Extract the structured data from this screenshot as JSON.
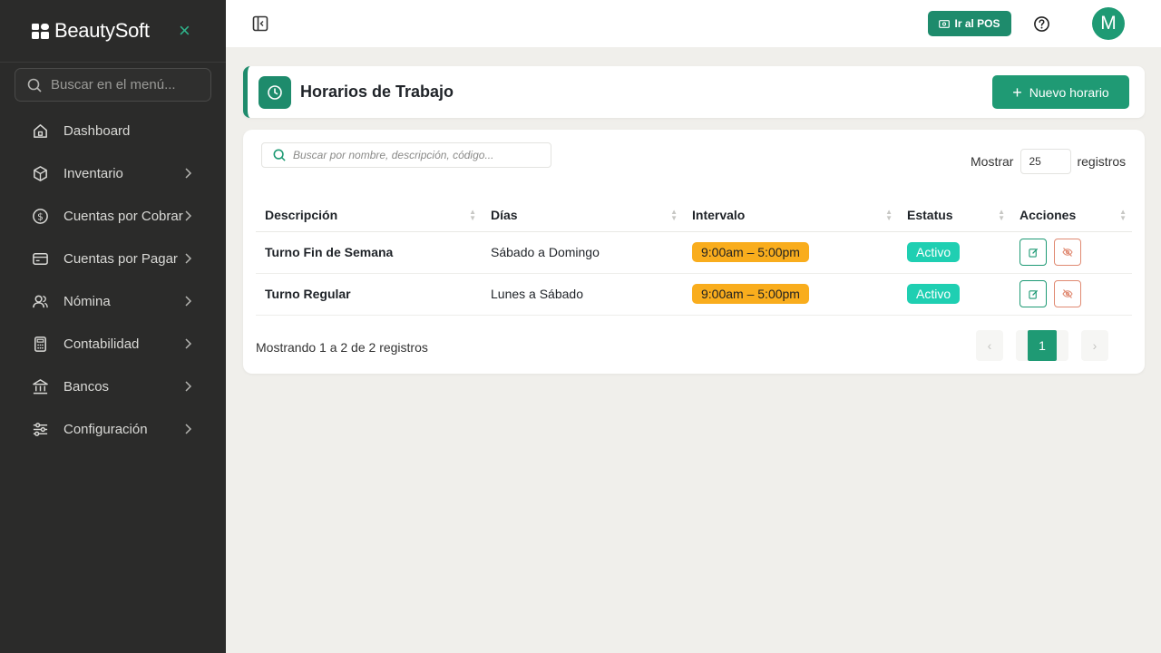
{
  "brand": {
    "name": "BeautySoft"
  },
  "sidebar": {
    "search_placeholder": "Buscar en el menú...",
    "items": [
      {
        "label": "Dashboard",
        "icon": "home-icon"
      },
      {
        "label": "Inventario",
        "icon": "box-icon"
      },
      {
        "label": "Cuentas por Cobrar",
        "icon": "dollar-icon"
      },
      {
        "label": "Cuentas por Pagar",
        "icon": "card-icon"
      },
      {
        "label": "Nómina",
        "icon": "users-icon"
      },
      {
        "label": "Contabilidad",
        "icon": "calculator-icon"
      },
      {
        "label": "Bancos",
        "icon": "bank-icon"
      },
      {
        "label": "Configuración",
        "icon": "sliders-icon"
      }
    ]
  },
  "topbar": {
    "pos_label": "Ir al POS",
    "avatar_initial": "M"
  },
  "page": {
    "title": "Horarios de Trabajo",
    "new_button": "Nuevo horario"
  },
  "table": {
    "search_placeholder": "Buscar por nombre, descripción, código...",
    "show_label": "Mostrar",
    "show_value": "25",
    "records_label": "registros",
    "columns": [
      "Descripción",
      "Días",
      "Intervalo",
      "Estatus",
      "Acciones"
    ],
    "rows": [
      {
        "description": "Turno Fin de Semana",
        "days": "Sábado a Domingo",
        "interval": "9:00am – 5:00pm",
        "status": "Activo"
      },
      {
        "description": "Turno Regular",
        "days": "Lunes a Sábado",
        "interval": "9:00am – 5:00pm",
        "status": "Activo"
      }
    ],
    "footer_info": "Mostrando 1 a 2 de 2 registros",
    "pager": {
      "prev": "‹",
      "current": "1",
      "next": "›"
    }
  },
  "colors": {
    "accent": "#1e8b6c",
    "sidebar_bg": "#2b2b2a",
    "interval_badge": "#f9ad1d",
    "status_badge": "#1fcfb2",
    "danger_outline": "#e08a72"
  }
}
